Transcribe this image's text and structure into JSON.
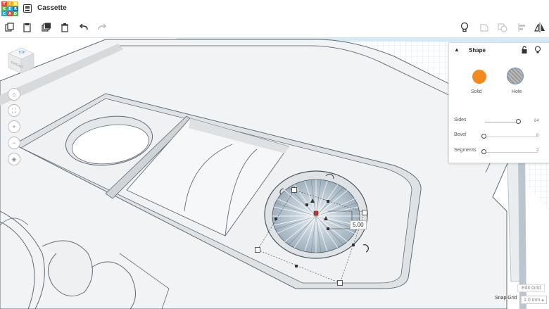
{
  "app": {
    "logo_letters": [
      "TIN",
      "KER",
      "CAD"
    ],
    "title": "Cassette"
  },
  "colors": {
    "accent": "#f28b1c",
    "grid": "#cde7f7",
    "workplane": "#a7d6f2"
  },
  "toolbar": {
    "icons": [
      "copy-icon",
      "paste-icon",
      "duplicate-icon",
      "delete-icon",
      "undo-icon",
      "redo-icon",
      "light-bulb-icon",
      "group-icon",
      "ungroup-icon",
      "align-icon",
      "mirror-icon"
    ]
  },
  "view_cube": {
    "top": "TOP",
    "front": "FRONT"
  },
  "nav": {
    "icons": [
      "home-icon",
      "fit-icon",
      "zoom-in-icon",
      "zoom-out-icon",
      "perspective-icon"
    ]
  },
  "shape_panel": {
    "title": "Shape",
    "solid_label": "Solid",
    "hole_label": "Hole",
    "selected": "Hole",
    "params": [
      {
        "label": "Sides",
        "value": "64",
        "fraction": 0.97
      },
      {
        "label": "Bevel",
        "value": "0",
        "fraction": 0.0
      },
      {
        "label": "Segments",
        "value": "2",
        "fraction": 0.0
      }
    ]
  },
  "dimension_label": "5.00",
  "bottom": {
    "edit_grid": "Edit Grid",
    "snap_label": "Snap Grid",
    "snap_value": "1.0 mm ▴"
  }
}
